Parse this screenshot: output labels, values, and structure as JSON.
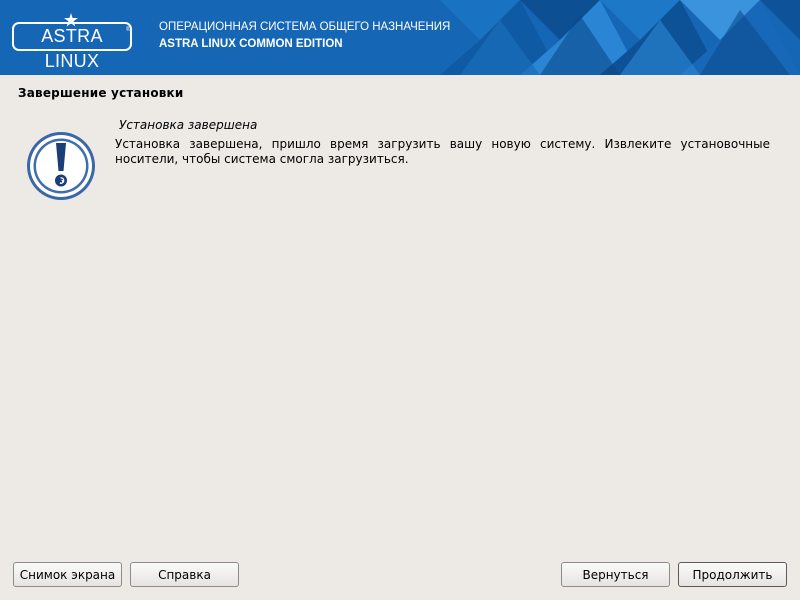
{
  "header": {
    "logo_text": "ASTRA LINUX",
    "logo_reg": "®",
    "line1": "ОПЕРАЦИОННАЯ СИСТЕМА ОБЩЕГО НАЗНАЧЕНИЯ",
    "line2": "ASTRA LINUX COMMON EDITION",
    "colors": {
      "background": "#1566b5",
      "accent": "#ffffff"
    }
  },
  "page": {
    "title": "Завершение установки"
  },
  "message": {
    "icon": "warning-exclamation-icon",
    "heading": "Установка завершена",
    "body": "Установка завершена, пришло время загрузить вашу новую систему. Извлеките установочные носители, чтобы система смогла загрузиться."
  },
  "buttons": {
    "screenshot": "Снимок экрана",
    "help": "Справка",
    "back": "Вернуться",
    "continue": "Продолжить"
  }
}
